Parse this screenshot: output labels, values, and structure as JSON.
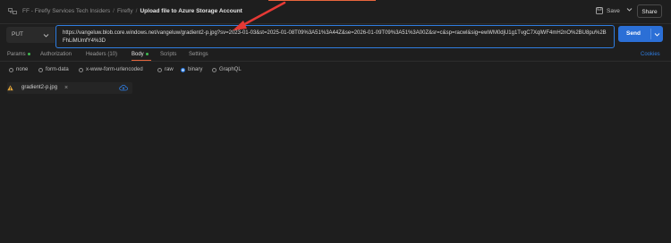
{
  "header": {
    "breadcrumbs": [
      "FF - Firefly Services Tech Insiders",
      "Firefly"
    ],
    "current": "Upload file to Azure Storage Account",
    "save_label": "Save",
    "share_label": "Share"
  },
  "request": {
    "method": "PUT",
    "url": "https://vangeluw.blob.core.windows.net/vangeluw/gradient2-p.jpg?sv=2023-01-03&st=2025-01-08T09%3A51%3A44Z&se=2026-01-09T09%3A51%3A00Z&sr=c&sp=racwl&sig=ewWM0djU1g1TvgC7XqlWF4mH2nO%2BU8pu%2BFhLiMUmfY4%3D",
    "send_label": "Send"
  },
  "tabs": {
    "params": "Params",
    "authorization": "Authorization",
    "headers": "Headers (10)",
    "body": "Body",
    "scripts": "Scripts",
    "settings": "Settings",
    "cookies": "Cookies",
    "active": "Body"
  },
  "body_modes": {
    "none": "none",
    "form_data": "form-data",
    "urlencoded": "x-www-form-urlencoded",
    "raw": "raw",
    "binary": "binary",
    "graphql": "GraphQL",
    "selected": "binary"
  },
  "file": {
    "name": "gradient2-p.jpg",
    "remove_label": "×"
  },
  "colors": {
    "accent": "#e8663d",
    "primary": "#2b6fd6",
    "status_dot": "#3fb950",
    "annotation_arrow": "#e53935"
  },
  "icons": [
    "collection-icon",
    "save-icon",
    "chevron-down-icon",
    "warning-icon",
    "upload-cloud-icon",
    "close-icon"
  ]
}
